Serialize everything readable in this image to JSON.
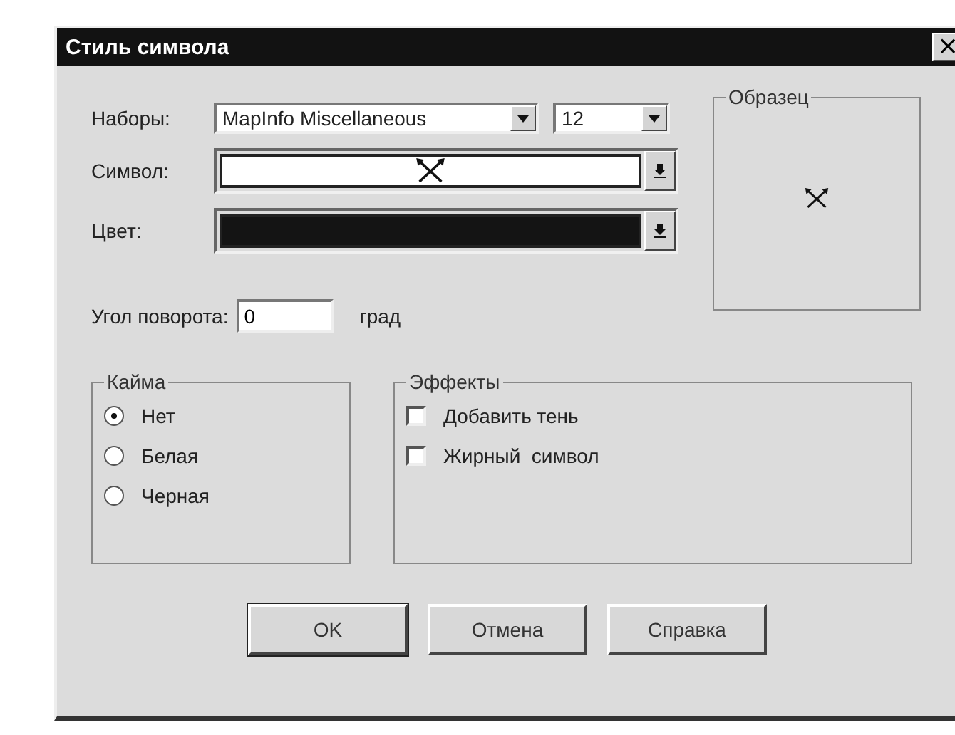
{
  "window": {
    "title": "Стиль символа",
    "close": "×"
  },
  "font_set": {
    "label": "Наборы:",
    "value": "MapInfo Miscellaneous"
  },
  "size": {
    "value": "12"
  },
  "symbol": {
    "label": "Символ:"
  },
  "color": {
    "label": "Цвет:",
    "color": "#141414"
  },
  "sample": {
    "title": "Образец"
  },
  "angle": {
    "label": "Угол поворота:",
    "value": "0",
    "unit": "град"
  },
  "border": {
    "title": "Кайма",
    "options": [
      {
        "label": "Нет",
        "selected": true
      },
      {
        "label": "Белая",
        "selected": false
      },
      {
        "label": "Черная",
        "selected": false
      }
    ]
  },
  "effects": {
    "title": "Эффекты",
    "options": [
      {
        "label": "Добавить тень",
        "checked": false
      },
      {
        "label": "Жирный  символ",
        "checked": false
      }
    ]
  },
  "buttons": [
    "OK",
    "Отмена",
    "Справка"
  ]
}
